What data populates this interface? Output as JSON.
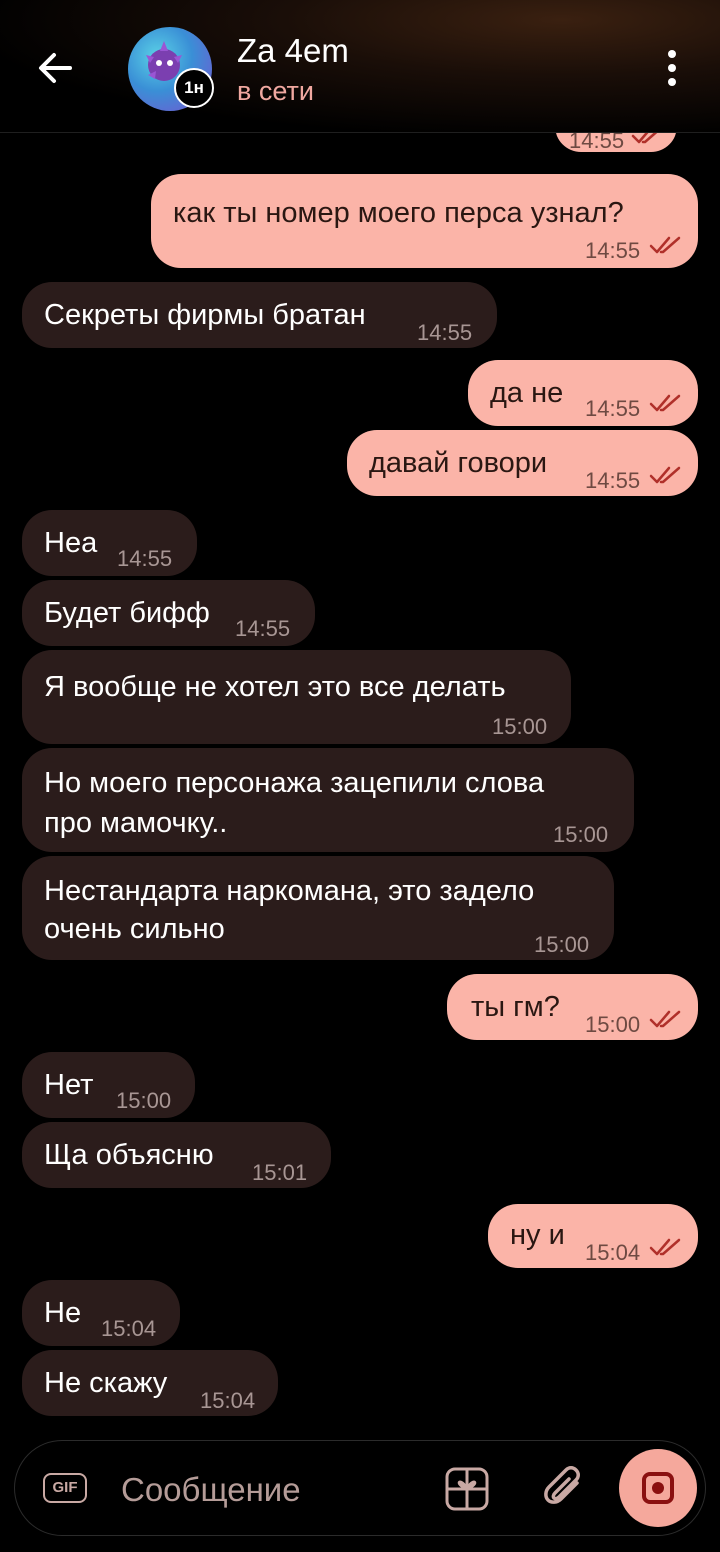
{
  "header": {
    "contact_name": "Za 4em",
    "status": "в сети",
    "story_badge": "1н"
  },
  "top_partial_time": "14:55",
  "messages": [
    {
      "dir": "out",
      "text": "как ты номер моего перса узнал?",
      "time": "14:55",
      "read": true
    },
    {
      "dir": "in",
      "text": "Секреты фирмы братан",
      "time": "14:55"
    },
    {
      "dir": "out",
      "text": "да не",
      "time": "14:55",
      "read": true
    },
    {
      "dir": "out",
      "text": "давай говори",
      "time": "14:55",
      "read": true
    },
    {
      "dir": "in",
      "text": "Неа",
      "time": "14:55"
    },
    {
      "dir": "in",
      "text": "Будет бифф",
      "time": "14:55"
    },
    {
      "dir": "in",
      "text": "Я вообще не хотел это все делать",
      "time": "15:00"
    },
    {
      "dir": "in",
      "text": "Но моего персонажа зацепили слова",
      "text2": "про мамочку..",
      "time": "15:00"
    },
    {
      "dir": "in",
      "text": "Нестандарта наркомана, это задело",
      "text2": "очень сильно",
      "time": "15:00"
    },
    {
      "dir": "out",
      "text": "ты гм?",
      "time": "15:00",
      "read": true
    },
    {
      "dir": "in",
      "text": "Нет",
      "time": "15:00"
    },
    {
      "dir": "in",
      "text": "Ща объясню",
      "time": "15:01"
    },
    {
      "dir": "out",
      "text": "ну и",
      "time": "15:04",
      "read": true
    },
    {
      "dir": "in",
      "text": "Не",
      "time": "15:04"
    },
    {
      "dir": "in",
      "text": "Не скажу",
      "time": "15:04"
    }
  ],
  "composer": {
    "gif_label": "GIF",
    "placeholder": "Сообщение"
  },
  "colors": {
    "incoming_bubble": "#2b1c1b",
    "outgoing_bubble": "#fbb4a8",
    "status_accent": "#f0a8a0",
    "read_ticks": "#b0302a"
  },
  "icons": [
    "back-arrow-icon",
    "menu-dots-icon",
    "gif-icon",
    "gift-icon",
    "paperclip-icon",
    "record-icon",
    "double-check-icon"
  ]
}
